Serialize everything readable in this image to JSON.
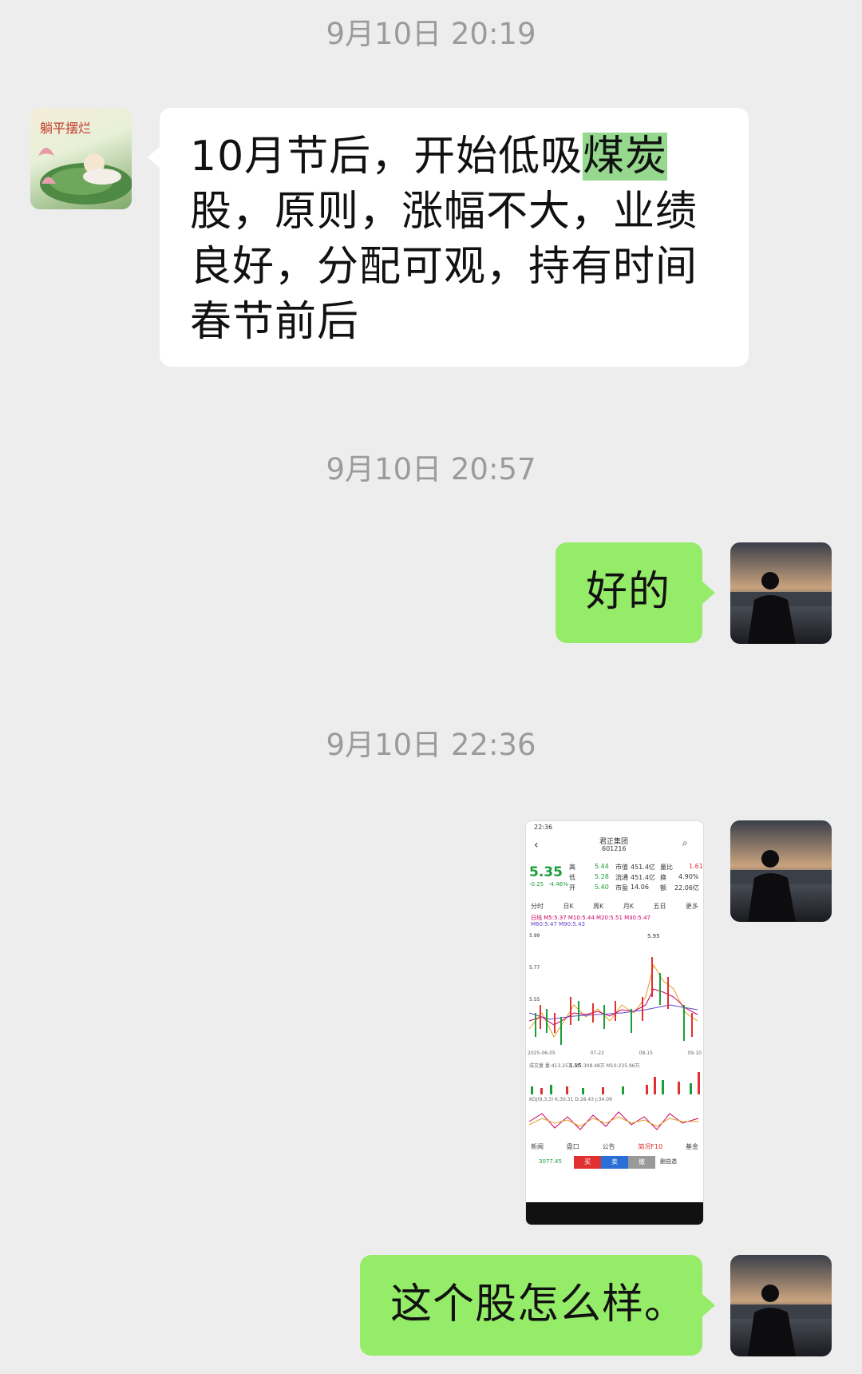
{
  "timestamps": [
    "9月10日 20:19",
    "9月10日 20:57",
    "9月10日 22:36"
  ],
  "messages": [
    {
      "side": "left",
      "text_before": "10月节后，开始低吸",
      "highlight": "煤炭",
      "text_after": "股，原则，涨幅不大，业绩良好，分配可观，持有时间春节前后",
      "avatar": "lotus-child-avatar",
      "avatar_text": "躺平摆烂"
    },
    {
      "side": "right",
      "text": "好的",
      "avatar": "silhouette-sunset-avatar"
    },
    {
      "side": "right",
      "type": "image",
      "avatar": "silhouette-sunset-avatar"
    },
    {
      "side": "right",
      "text": "这个股怎么样。",
      "avatar": "silhouette-sunset-avatar"
    }
  ],
  "stock_screenshot": {
    "time": "22:36",
    "name": "君正集团",
    "code": "601216",
    "price": "5.35",
    "change": "-0.25",
    "change_pct": "-4.46%",
    "high_label": "高",
    "high": "5.44",
    "low_label": "低",
    "low": "5.28",
    "open_label": "开",
    "open": "5.40",
    "mcap_label": "市值",
    "mcap": "451.4亿",
    "float_label": "流通",
    "float": "451.4亿",
    "pe_label": "市盈",
    "pe": "14.06",
    "vr_label": "量比",
    "vr": "1.61",
    "turn_label": "换",
    "turn": "4.90%",
    "amt_label": "额",
    "amt": "22.06亿",
    "tabs": [
      "分时",
      "日K",
      "周K",
      "月K",
      "五日",
      "更多"
    ],
    "ma_line1": "日线 M5:5.37 M10:5.44 M20:5.51 M30:5.47",
    "ma_line2": "M60:5.47 M90:5.43",
    "peak": "5.95",
    "low_mark": "5.15",
    "y_labels": [
      "5.99",
      "5.77",
      "5.55"
    ],
    "dates": [
      "2025-06-05",
      "07-22",
      "08-15",
      "09-10"
    ],
    "vol_line": "成交量 量:413.25万 M5:308.48万 M10:235.96万",
    "kdj_line": "KDJ(9,3,3) K:30.31 D:28.43 J:34.09",
    "bottom_tabs": [
      "新闻",
      "盘口",
      "公告",
      "简况F10",
      "基金"
    ],
    "index_value": "3077.45",
    "buttons": [
      "买",
      "卖",
      "撤",
      "删自选"
    ]
  },
  "colors": {
    "bubble_green": "#95ec69",
    "highlight": "#95d88e",
    "stock_up": "#e03030",
    "stock_down": "#1a9e3a"
  }
}
